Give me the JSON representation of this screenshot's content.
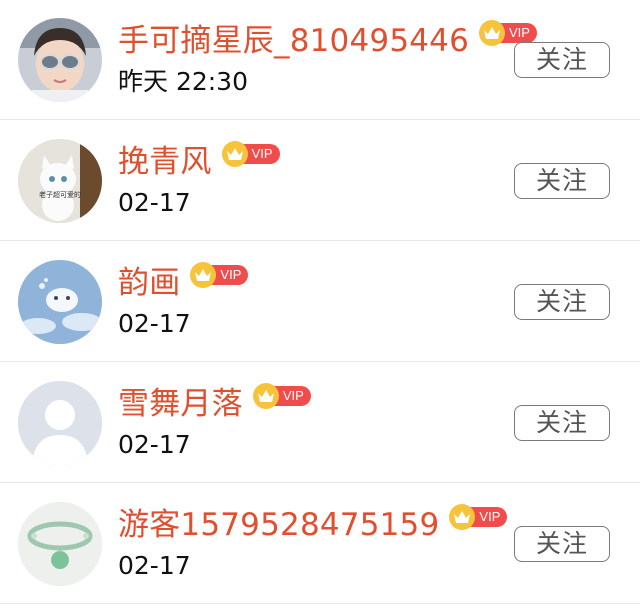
{
  "users": [
    {
      "name": "手可摘星辰_810495446",
      "time": "昨天 22:30",
      "vip_label": "VIP",
      "follow_label": "关注",
      "avatar": "girl-with-sunglasses-photo"
    },
    {
      "name": "挽青风",
      "time": "02-17",
      "vip_label": "VIP",
      "follow_label": "关注",
      "avatar": "white-cat-photo",
      "avatar_caption": "老子超可爱的"
    },
    {
      "name": "韵画",
      "time": "02-17",
      "vip_label": "VIP",
      "follow_label": "关注",
      "avatar": "blue-cloud-cartoon"
    },
    {
      "name": "雪舞月落",
      "time": "02-17",
      "vip_label": "VIP",
      "follow_label": "关注",
      "avatar": "default-person-silhouette"
    },
    {
      "name": "游客1579528475159",
      "time": "02-17",
      "vip_label": "VIP",
      "follow_label": "关注",
      "avatar": "jade-bracelet-photo"
    }
  ],
  "colors": {
    "name": "#e0502f",
    "vip_badge": "#f14c4c",
    "crown": "#f6c33b",
    "follow_border": "#7a7a7a"
  }
}
